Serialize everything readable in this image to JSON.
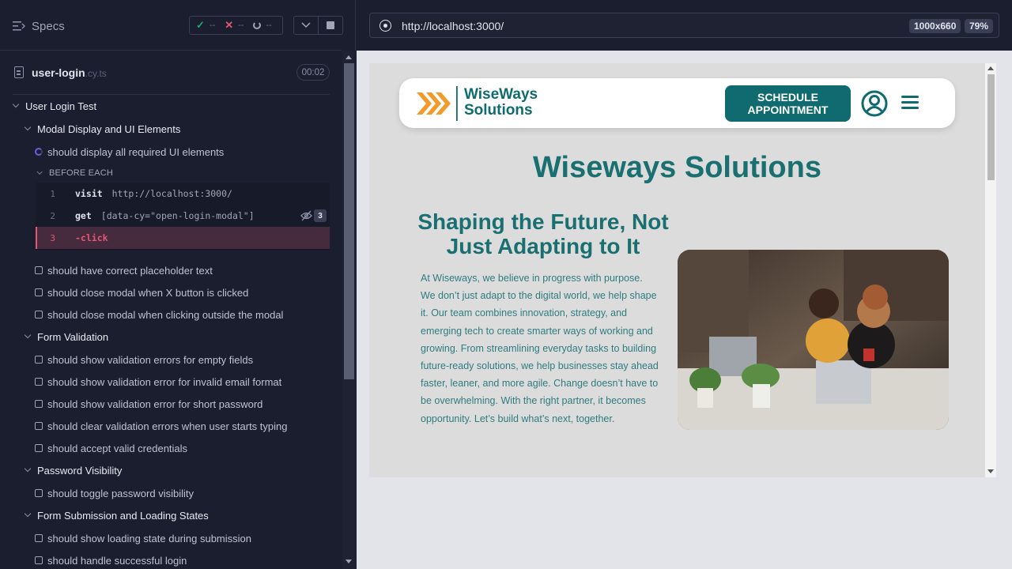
{
  "reporter": {
    "specs_label": "Specs",
    "stats": {
      "passed": "--",
      "failed": "--",
      "pending": "--"
    },
    "spec": {
      "name": "user-login",
      "ext": ".cy.ts",
      "duration": "00:02"
    },
    "root_suite": "User Login Test",
    "suites": [
      {
        "title": "Modal Display and UI Elements",
        "tests": [
          {
            "title": "should display all required UI elements",
            "state": "running"
          }
        ],
        "hook": "BEFORE EACH",
        "commands": [
          {
            "num": "1",
            "name": "visit",
            "message": "http://localhost:3000/"
          },
          {
            "num": "2",
            "name": "get",
            "message": "[data-cy=\"open-login-modal\"]",
            "count": "3"
          },
          {
            "num": "3",
            "name": "-click",
            "message": ""
          }
        ],
        "more_tests": [
          "should have correct placeholder text",
          "should close modal when X button is clicked",
          "should close modal when clicking outside the modal"
        ]
      },
      {
        "title": "Form Validation",
        "tests": [
          "should show validation errors for empty fields",
          "should show validation error for invalid email format",
          "should show validation error for short password",
          "should clear validation errors when user starts typing",
          "should accept valid credentials"
        ]
      },
      {
        "title": "Password Visibility",
        "tests": [
          "should toggle password visibility"
        ]
      },
      {
        "title": "Form Submission and Loading States",
        "tests": [
          "should show loading state during submission",
          "should handle successful login"
        ]
      }
    ]
  },
  "aut": {
    "url": "http://localhost:3000/",
    "viewport": "1000x660",
    "zoom": "79%"
  },
  "site": {
    "logo_line1": "WiseWays",
    "logo_line2": "Solutions",
    "schedule_button": "SCHEDULE APPOINTMENT",
    "hero_title": "Wiseways Solutions",
    "sub_title": "Shaping the Future, Not Just Adapting to It",
    "body": "At Wiseways, we believe in progress with purpose. We don’t just adapt to the digital world, we help shape it. Our team combines innovation, strategy, and emerging tech to create smarter ways of working and growing. From streamlining everyday tasks to building future-ready solutions, we help businesses stay ahead faster, leaner, and more agile. Change doesn’t have to be overwhelming. With the right partner, it becomes opportunity. Let’s build what’s next, together."
  },
  "colors": {
    "brand_teal": "#0f6b6f",
    "logo_orange": "#f39a2b",
    "pass": "#1fa971",
    "fail": "#e45770",
    "running": "#6f5de6"
  }
}
